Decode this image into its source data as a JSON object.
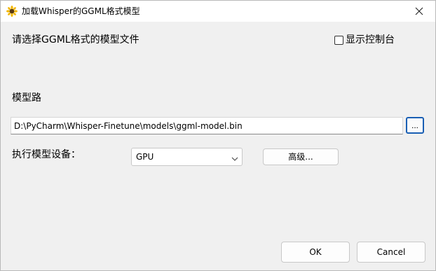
{
  "window": {
    "title": "加载Whisper的GGML格式模型"
  },
  "dialog": {
    "prompt": "请选择GGML格式的模型文件",
    "console_checkbox": {
      "label": "显示控制台",
      "checked": false
    },
    "path_label": "模型路",
    "path_value": "D:\\PyCharm\\Whisper-Finetune\\models\\ggml-model.bin",
    "browse_label": "...",
    "device_label": "执行模型设备：",
    "device_value": "GPU",
    "advanced_label": "高级...",
    "ok_label": "OK",
    "cancel_label": "Cancel"
  },
  "icons": {
    "app": "sunflower-icon",
    "close": "close-icon",
    "dropdown": "chevron-down-icon"
  },
  "colors": {
    "accent": "#1a5fb4",
    "dialog_background": "#f0f0f0",
    "titlebar_background": "#ffffff"
  }
}
